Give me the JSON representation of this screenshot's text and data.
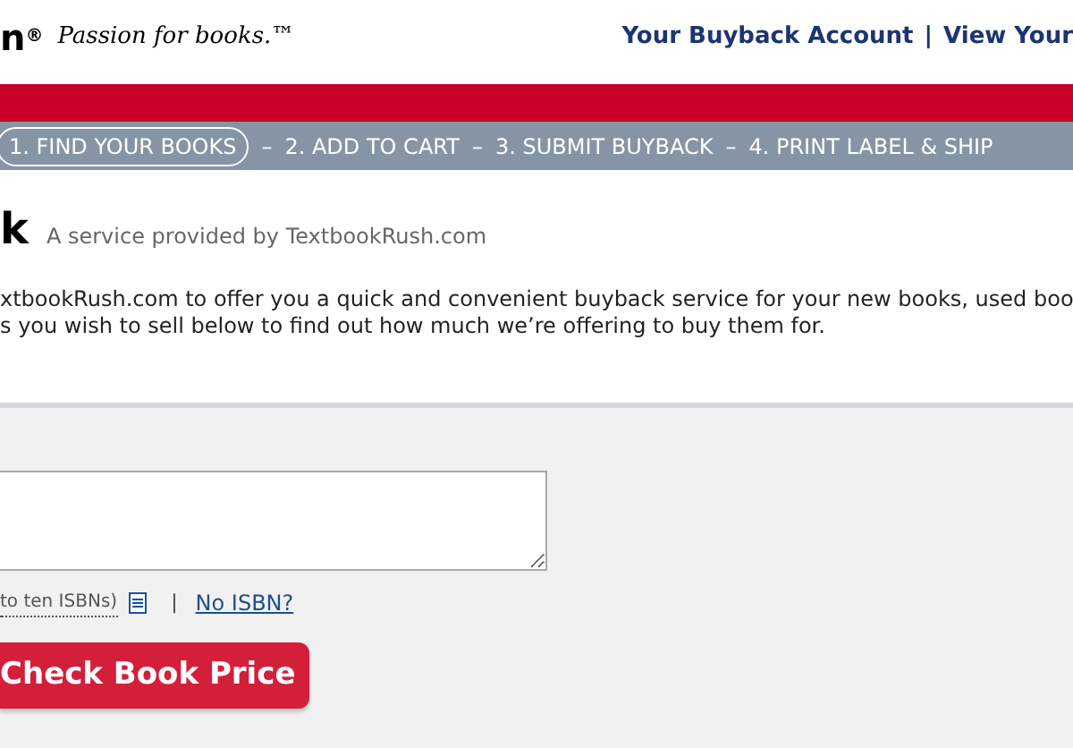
{
  "header": {
    "logo_fragment": "n",
    "logo_mark": "®",
    "tagline": "Passion for books.™",
    "links": [
      {
        "label": "Your Buyback Account"
      },
      {
        "label": "View Your"
      }
    ],
    "separator": "|"
  },
  "steps": [
    {
      "label": "1. FIND YOUR BOOKS",
      "selected": true
    },
    {
      "label": "2. ADD TO CART",
      "selected": false
    },
    {
      "label": "3. SUBMIT BUYBACK",
      "selected": false
    },
    {
      "label": "4. PRINT LABEL & SHIP",
      "selected": false
    }
  ],
  "step_separator": "–",
  "intro": {
    "title": "k",
    "subtitle": "A service provided by TextbookRush.com",
    "lines": [
      "xtbookRush.com to offer you a quick and convenient buyback service for your new books, used boo",
      "s you wish to sell below to find out how much we’re offering to buy them for."
    ]
  },
  "form": {
    "isbn_hint": "to ten ISBNs)",
    "separator": "|",
    "no_isbn_link": "No ISBN?",
    "submit": "Check Book Price"
  }
}
